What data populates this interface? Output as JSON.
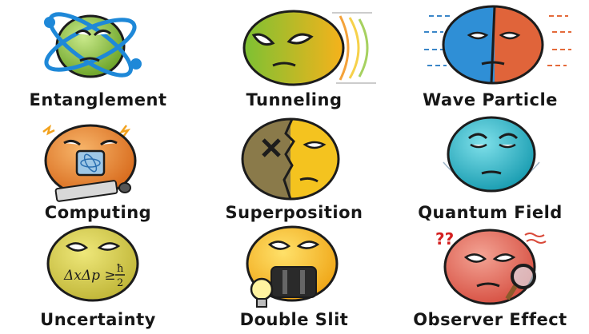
{
  "cards": [
    {
      "id": "entanglement",
      "label": "Entanglement",
      "icon": "atom-orbit-icon",
      "color": "#8fc63f"
    },
    {
      "id": "tunneling",
      "label": "Tunneling",
      "icon": "speed-lines-icon",
      "color": "#f2c12e"
    },
    {
      "id": "wave-particle",
      "label": "Wave Particle",
      "icon": "split-face-icon",
      "color": "#e0643a"
    },
    {
      "id": "computing",
      "label": "Computing",
      "icon": "chip-keyboard-icon",
      "color": "#e8822f"
    },
    {
      "id": "superposition",
      "label": "Superposition",
      "icon": "half-cracked-face-icon",
      "color": "#f3c623"
    },
    {
      "id": "quantum-field",
      "label": "Quantum Field",
      "icon": "funnel-field-icon",
      "color": "#29b6c6"
    },
    {
      "id": "uncertainty",
      "label": "Uncertainty",
      "icon": "formula-face-icon",
      "color": "#d9d04a"
    },
    {
      "id": "double-slit",
      "label": "Double Slit",
      "icon": "lightbulb-slit-icon",
      "color": "#f4c21f"
    },
    {
      "id": "observer-effect",
      "label": "Observer Effect",
      "icon": "magnifier-question-icon",
      "color": "#e0695b"
    }
  ],
  "uncertainty_formula": {
    "lhs": "ΔxΔp ≥",
    "num": "ħ",
    "den": "2"
  },
  "question_marks": "??"
}
